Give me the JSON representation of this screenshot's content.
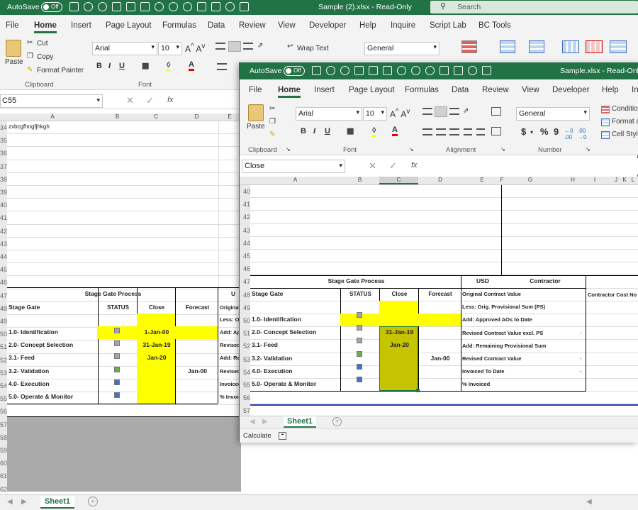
{
  "back_window": {
    "autosave_label": "AutoSave",
    "toggle_state": "Off",
    "title": "Sample (2).xlsx  -  Read-Only",
    "search_placeholder": "Search",
    "menu": [
      "File",
      "Home",
      "Insert",
      "Page Layout",
      "Formulas",
      "Data",
      "Review",
      "View",
      "Developer",
      "Help",
      "Inquire",
      "Script Lab",
      "BC Tools"
    ],
    "clipboard": {
      "paste": "Paste",
      "cut": "Cut",
      "copy": "Copy",
      "format_painter": "Format Painter",
      "group": "Clipboard"
    },
    "font": {
      "name": "Arial",
      "size": "10",
      "group": "Font"
    },
    "wrap_text": "Wrap Text",
    "number_format": "General",
    "name_box": "C55",
    "fx": "fx",
    "col_headers": [
      "A",
      "B",
      "C",
      "D",
      "E"
    ],
    "row_numbers": [
      "34",
      "35",
      "36",
      "37",
      "38",
      "39",
      "40",
      "41",
      "42",
      "43",
      "44",
      "45",
      "46",
      "47",
      "48",
      "49",
      "50",
      "51",
      "52",
      "53",
      "54",
      "55",
      "56",
      "57",
      "58",
      "59",
      "60",
      "61",
      "62"
    ],
    "a34": "zxbcgfhngfjhkgh",
    "table_title": "Stage Gate Process",
    "usd_partial": "U",
    "headers": {
      "stage_gate": "Stage Gate",
      "status": "STATUS",
      "close": "Close",
      "forecast": "Forecast",
      "original": "Original"
    },
    "rows": [
      {
        "stage": "1.0- Identification",
        "close": "1-Jan-00",
        "forecast": "",
        "right": "Add: Ap"
      },
      {
        "stage": "2.0- Concept Selection",
        "close": "31-Jan-19",
        "forecast": "",
        "right": "Revised"
      },
      {
        "stage": "3.1- Feed",
        "close": "Jan-20",
        "forecast": "",
        "right": "Add: Re"
      },
      {
        "stage": "3.2- Validation",
        "close": "",
        "forecast": "Jan-00",
        "right": "Revised"
      },
      {
        "stage": "4.0- Execution",
        "close": "",
        "forecast": "",
        "right": "Invoiced"
      },
      {
        "stage": "5.0- Operate & Monitor",
        "close": "",
        "forecast": "",
        "right": "% Invoic"
      }
    ],
    "less_partial": "Less: Or",
    "sheet_tab": "Sheet1"
  },
  "front_window": {
    "autosave_label": "AutoSave",
    "toggle_state": "Off",
    "title": "Sample.xlsx  -  Read-Only",
    "menu": [
      "File",
      "Home",
      "Insert",
      "Page Layout",
      "Formulas",
      "Data",
      "Review",
      "View",
      "Developer",
      "Help",
      "In"
    ],
    "clipboard": {
      "paste": "Paste",
      "group": "Clipboard"
    },
    "font": {
      "name": "Arial",
      "size": "10",
      "group": "Font"
    },
    "alignment_group": "Alignment",
    "number": {
      "format": "General",
      "currency": "$",
      "percent": "%",
      "comma": "9",
      "group": "Number"
    },
    "styles": [
      "Condition",
      "Format a",
      "Cell Style"
    ],
    "name_box": "Close",
    "fx": "fx",
    "col_headers": [
      "A",
      "B",
      "C",
      "D",
      "E",
      "F",
      "G",
      "H",
      "I",
      "J",
      "K",
      "L"
    ],
    "row_numbers": [
      "40",
      "41",
      "42",
      "43",
      "44",
      "45",
      "46",
      "47",
      "48",
      "49",
      "50",
      "51",
      "52",
      "53",
      "54",
      "55",
      "56",
      "57"
    ],
    "table_title": "Stage Gate Process",
    "usd": "USD",
    "contractor": "Contractor",
    "contractor_cost": "Contractor Cost No",
    "headers": {
      "stage_gate": "Stage Gate",
      "status": "STATUS",
      "close": "Close",
      "forecast": "Forecast"
    },
    "right_labels": [
      "Original Contract Value",
      "Less: Orig. Provisional Sum (PS)",
      "Add: Approved AOs to Date",
      "Revised Contract Value excl. PS",
      "Add: Remaining Provisional Sum",
      "Revised Contract Value",
      "Invoiced To Date",
      "% Invoiced"
    ],
    "dash": "-",
    "rows": [
      {
        "stage": "1.0- Identification",
        "close": "",
        "forecast": ""
      },
      {
        "stage": "2.0- Concept Selection",
        "close": "31-Jan-19",
        "forecast": ""
      },
      {
        "stage": "3.1- Feed",
        "close": "Jan-20",
        "forecast": ""
      },
      {
        "stage": "3.2- Validation",
        "close": "",
        "forecast": "Jan-00"
      },
      {
        "stage": "4.0- Execution",
        "close": "",
        "forecast": ""
      },
      {
        "stage": "5.0- Operate & Monitor",
        "close": "",
        "forecast": ""
      }
    ],
    "sheet_tab": "Sheet1",
    "status_bar": "Calculate"
  },
  "colors": {
    "excel_green": "#217346",
    "highlight_yellow": "#ffff00",
    "selected_olive": "#c4c400",
    "status_grey": "#a6a6a6",
    "status_green": "#70ad47",
    "status_blue": "#4472c4"
  }
}
